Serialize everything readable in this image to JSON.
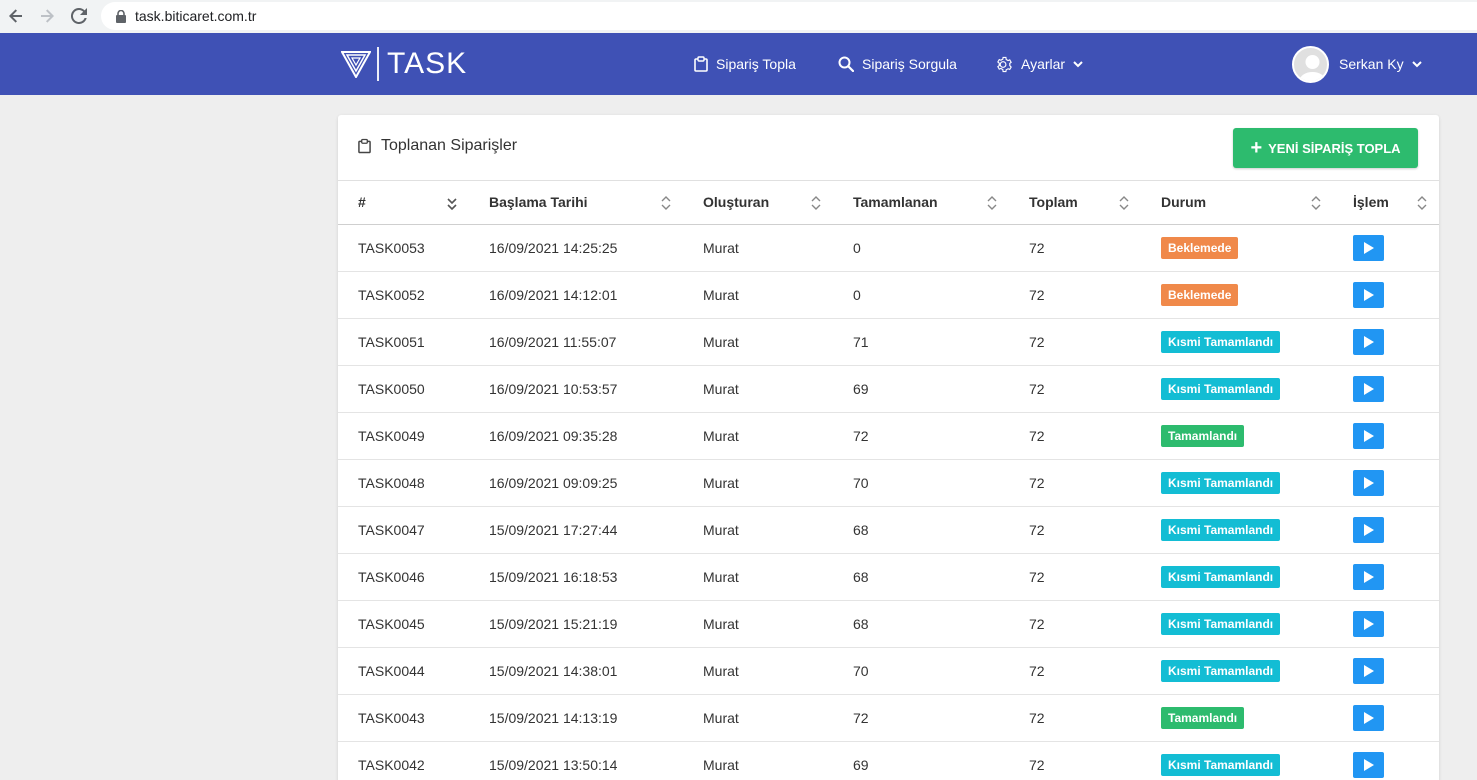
{
  "browser": {
    "url": "task.biticaret.com.tr"
  },
  "header": {
    "logo_text": "TASK",
    "menu": [
      {
        "label": "Sipariş Topla",
        "icon": "clipboard-icon"
      },
      {
        "label": "Sipariş Sorgula",
        "icon": "search-icon"
      },
      {
        "label": "Ayarlar",
        "icon": "gear-icon"
      }
    ],
    "user_name": "Serkan Ky",
    "color": "#3f51b5"
  },
  "card": {
    "title": "Toplanan Siparişler",
    "new_button_label": "YENİ SİPARİŞ TOPLA"
  },
  "table": {
    "columns": [
      "#",
      "Başlama Tarihi",
      "Oluşturan",
      "Tamamlanan",
      "Toplam",
      "Durum",
      "İşlem"
    ],
    "rows": [
      {
        "id": "TASK0053",
        "date": "16/09/2021 14:25:25",
        "creator": "Murat",
        "completed": "0",
        "total": "72",
        "status": "Beklemede",
        "status_type": "wait"
      },
      {
        "id": "TASK0052",
        "date": "16/09/2021 14:12:01",
        "creator": "Murat",
        "completed": "0",
        "total": "72",
        "status": "Beklemede",
        "status_type": "wait"
      },
      {
        "id": "TASK0051",
        "date": "16/09/2021 11:55:07",
        "creator": "Murat",
        "completed": "71",
        "total": "72",
        "status": "Kısmi Tamamlandı",
        "status_type": "partial"
      },
      {
        "id": "TASK0050",
        "date": "16/09/2021 10:53:57",
        "creator": "Murat",
        "completed": "69",
        "total": "72",
        "status": "Kısmi Tamamlandı",
        "status_type": "partial"
      },
      {
        "id": "TASK0049",
        "date": "16/09/2021 09:35:28",
        "creator": "Murat",
        "completed": "72",
        "total": "72",
        "status": "Tamamlandı",
        "status_type": "done"
      },
      {
        "id": "TASK0048",
        "date": "16/09/2021 09:09:25",
        "creator": "Murat",
        "completed": "70",
        "total": "72",
        "status": "Kısmi Tamamlandı",
        "status_type": "partial"
      },
      {
        "id": "TASK0047",
        "date": "15/09/2021 17:27:44",
        "creator": "Murat",
        "completed": "68",
        "total": "72",
        "status": "Kısmi Tamamlandı",
        "status_type": "partial"
      },
      {
        "id": "TASK0046",
        "date": "15/09/2021 16:18:53",
        "creator": "Murat",
        "completed": "68",
        "total": "72",
        "status": "Kısmi Tamamlandı",
        "status_type": "partial"
      },
      {
        "id": "TASK0045",
        "date": "15/09/2021 15:21:19",
        "creator": "Murat",
        "completed": "68",
        "total": "72",
        "status": "Kısmi Tamamlandı",
        "status_type": "partial"
      },
      {
        "id": "TASK0044",
        "date": "15/09/2021 14:38:01",
        "creator": "Murat",
        "completed": "70",
        "total": "72",
        "status": "Kısmi Tamamlandı",
        "status_type": "partial"
      },
      {
        "id": "TASK0043",
        "date": "15/09/2021 14:13:19",
        "creator": "Murat",
        "completed": "72",
        "total": "72",
        "status": "Tamamlandı",
        "status_type": "done"
      },
      {
        "id": "TASK0042",
        "date": "15/09/2021 13:50:14",
        "creator": "Murat",
        "completed": "69",
        "total": "72",
        "status": "Kısmi Tamamlandı",
        "status_type": "partial"
      }
    ]
  },
  "status_colors": {
    "wait": "#f0894a",
    "partial": "#13bdd4",
    "done": "#2dbb6e"
  }
}
